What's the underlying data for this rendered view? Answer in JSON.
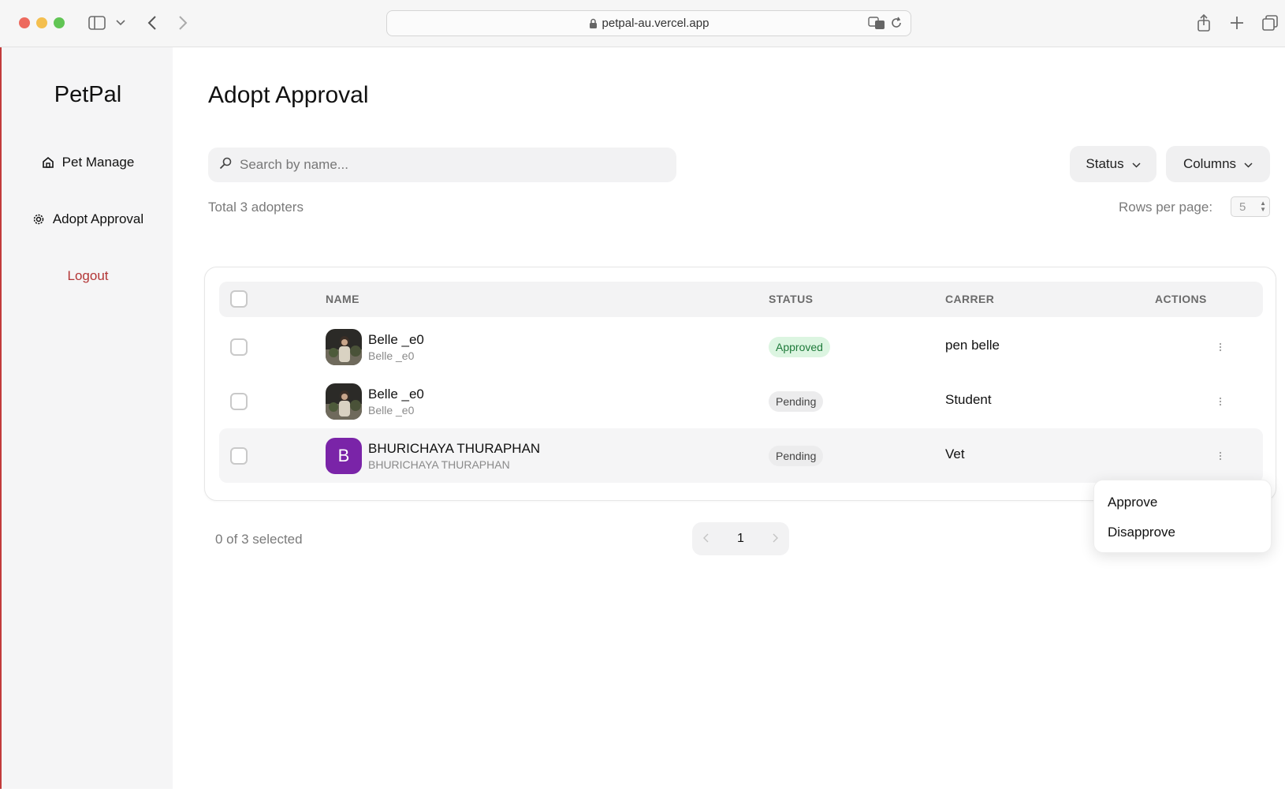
{
  "browser": {
    "url": "petpal-au.vercel.app"
  },
  "sidebar": {
    "brand": "PetPal",
    "items": [
      {
        "label": "Pet Manage",
        "icon": "home-icon"
      },
      {
        "label": "Adopt Approval",
        "icon": "gear-icon"
      },
      {
        "label": "Logout"
      }
    ]
  },
  "main": {
    "title": "Adopt Approval",
    "search_placeholder": "Search by name...",
    "status_button": "Status",
    "columns_button": "Columns",
    "total_text": "Total 3 adopters",
    "rows_per_page_label": "Rows per page:",
    "rows_per_page_value": "5"
  },
  "table": {
    "headers": {
      "name": "NAME",
      "status": "STATUS",
      "carrer": "CARRER",
      "actions": "ACTIONS"
    },
    "rows": [
      {
        "name": "Belle _e0",
        "sub": "Belle _e0",
        "status": "Approved",
        "carrer": "pen belle",
        "avatar": "photo"
      },
      {
        "name": "Belle _e0",
        "sub": "Belle _e0",
        "status": "Pending",
        "carrer": "Student",
        "avatar": "photo"
      },
      {
        "name": "BHURICHAYA THURAPHAN",
        "sub": "BHURICHAYA THURAPHAN",
        "status": "Pending",
        "carrer": "Vet",
        "avatar_letter": "B"
      }
    ]
  },
  "footer": {
    "selected_text": "0 of 3 selected",
    "current_page": "1"
  },
  "action_menu": {
    "approve": "Approve",
    "disapprove": "Disapprove"
  },
  "colors": {
    "approved_bg": "#dcf5e1",
    "approved_text": "#1e7a3a",
    "logout": "#b33636",
    "avatar_purple": "#7a24a8"
  }
}
